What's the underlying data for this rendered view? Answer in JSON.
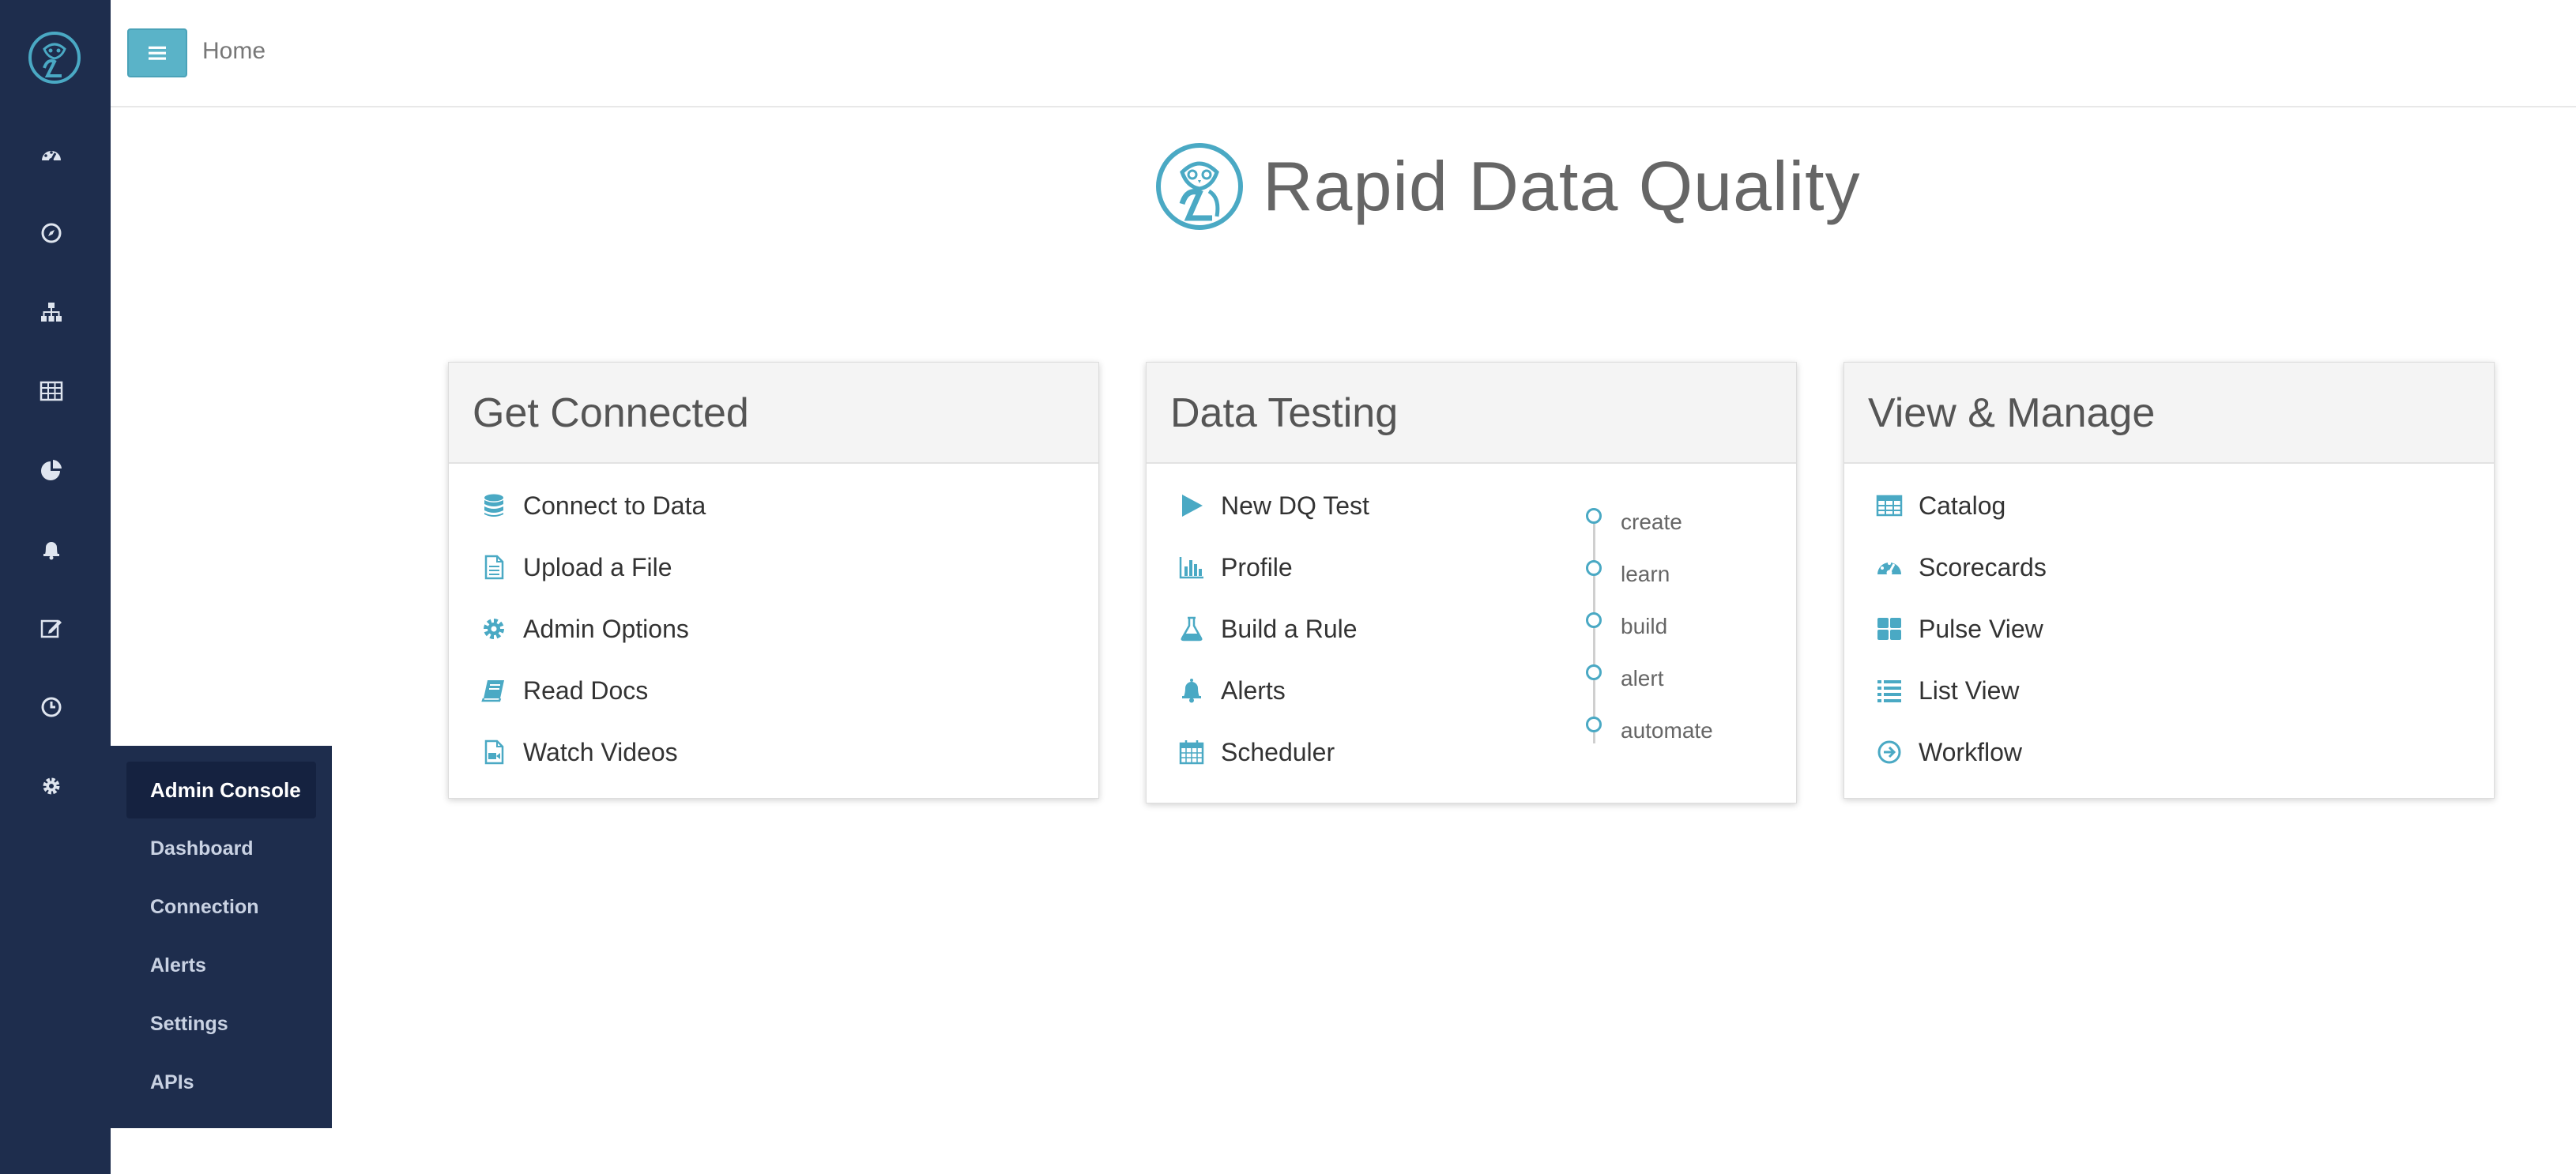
{
  "header": {
    "breadcrumb": "Home"
  },
  "hero": {
    "title": "Rapid Data Quality"
  },
  "sidebar": {
    "icons": [
      "dashboard-icon",
      "compass-icon",
      "sitemap-icon",
      "table-icon",
      "pie-chart-icon",
      "bell-icon",
      "edit-icon",
      "clock-icon",
      "gear-icon"
    ]
  },
  "admin_menu": {
    "title": "Admin Console",
    "items": [
      "Dashboard",
      "Connection",
      "Alerts",
      "Settings",
      "APIs"
    ]
  },
  "cards": {
    "connected": {
      "title": "Get Connected",
      "items": [
        {
          "label": "Connect to Data",
          "icon": "database-icon"
        },
        {
          "label": "Upload a File",
          "icon": "file-icon"
        },
        {
          "label": "Admin Options",
          "icon": "gear-icon"
        },
        {
          "label": "Read Docs",
          "icon": "book-icon"
        },
        {
          "label": "Watch Videos",
          "icon": "video-file-icon"
        }
      ]
    },
    "testing": {
      "title": "Data Testing",
      "items": [
        {
          "label": "New DQ Test",
          "icon": "play-icon"
        },
        {
          "label": "Profile",
          "icon": "bar-chart-icon"
        },
        {
          "label": "Build a Rule",
          "icon": "flask-icon"
        },
        {
          "label": "Alerts",
          "icon": "bell-icon"
        },
        {
          "label": "Scheduler",
          "icon": "calendar-icon"
        }
      ],
      "steps": [
        "create",
        "learn",
        "build",
        "alert",
        "automate"
      ]
    },
    "manage": {
      "title": "View & Manage",
      "items": [
        {
          "label": "Catalog",
          "icon": "table-icon"
        },
        {
          "label": "Scorecards",
          "icon": "dashboard-icon"
        },
        {
          "label": "Pulse View",
          "icon": "grid-icon"
        },
        {
          "label": "List View",
          "icon": "list-icon"
        },
        {
          "label": "Workflow",
          "icon": "arrow-circle-icon"
        }
      ]
    }
  },
  "colors": {
    "sidebar": "#1e2d4d",
    "accent": "#4aa9c4",
    "menu_button": "#5ab3c8"
  }
}
